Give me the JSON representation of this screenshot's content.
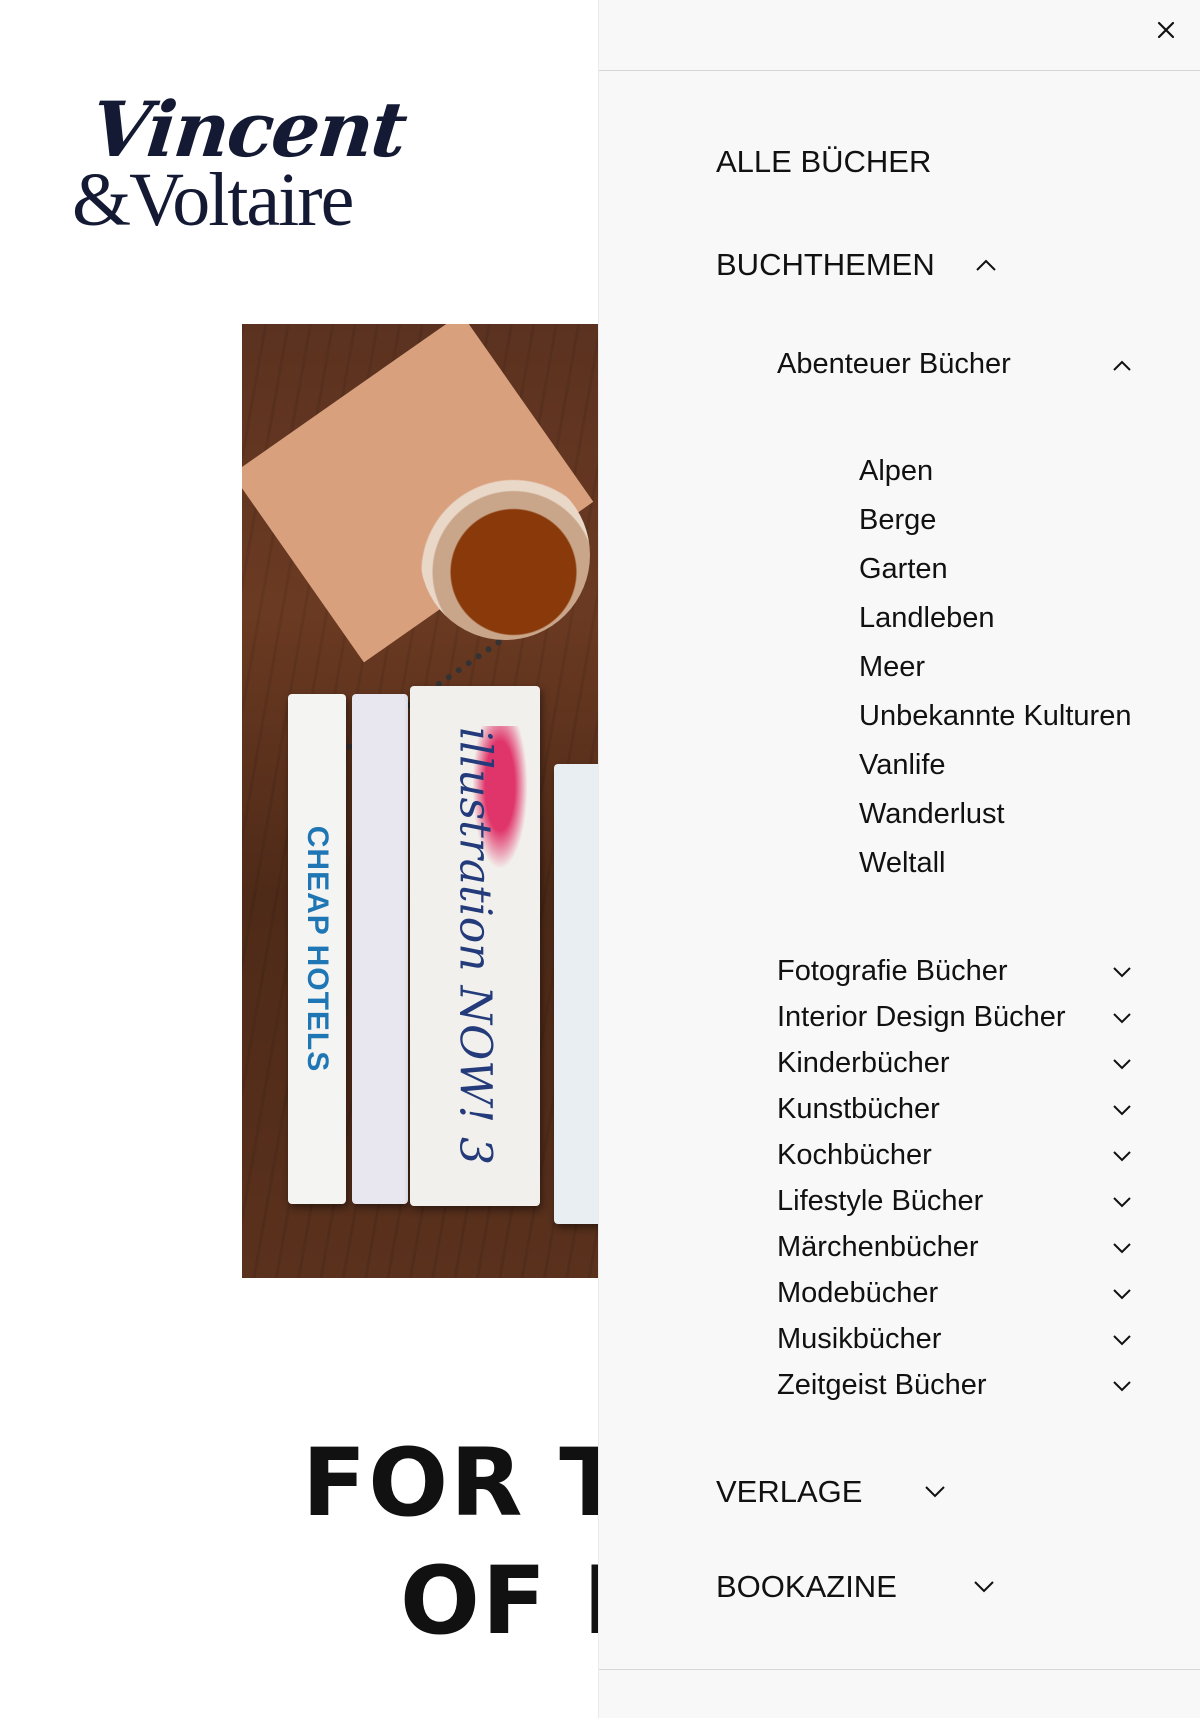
{
  "logo": {
    "line1": "Vincent",
    "line2": "&Voltaire"
  },
  "photo": {
    "book1_spine": "CHEAP HOTELS",
    "book3_spine": "illustration NOW! 3"
  },
  "hero": {
    "line1": "FOR TH",
    "line2": "OF B"
  },
  "drawer": {
    "close_icon": "close-icon",
    "alle_buecher": "ALLE BÜCHER",
    "buchthemen": {
      "label": "BUCHTHEMEN",
      "expanded": true
    },
    "abenteuer": {
      "label": "Abenteuer Bücher",
      "expanded": true,
      "items": [
        "Alpen",
        "Berge",
        "Garten",
        "Landleben",
        "Meer",
        "Unbekannte Kulturen",
        "Vanlife",
        "Wanderlust",
        "Weltall"
      ]
    },
    "categories": [
      "Fotografie Bücher",
      "Interior Design Bücher",
      "Kinderbücher",
      "Kunstbücher",
      "Kochbücher",
      "Lifestyle Bücher",
      "Märchenbücher",
      "Modebücher",
      "Musikbücher",
      "Zeitgeist Bücher"
    ],
    "verlage": {
      "label": "VERLAGE",
      "expanded": false
    },
    "bookazine": {
      "label": "BOOKAZINE",
      "expanded": false
    }
  }
}
